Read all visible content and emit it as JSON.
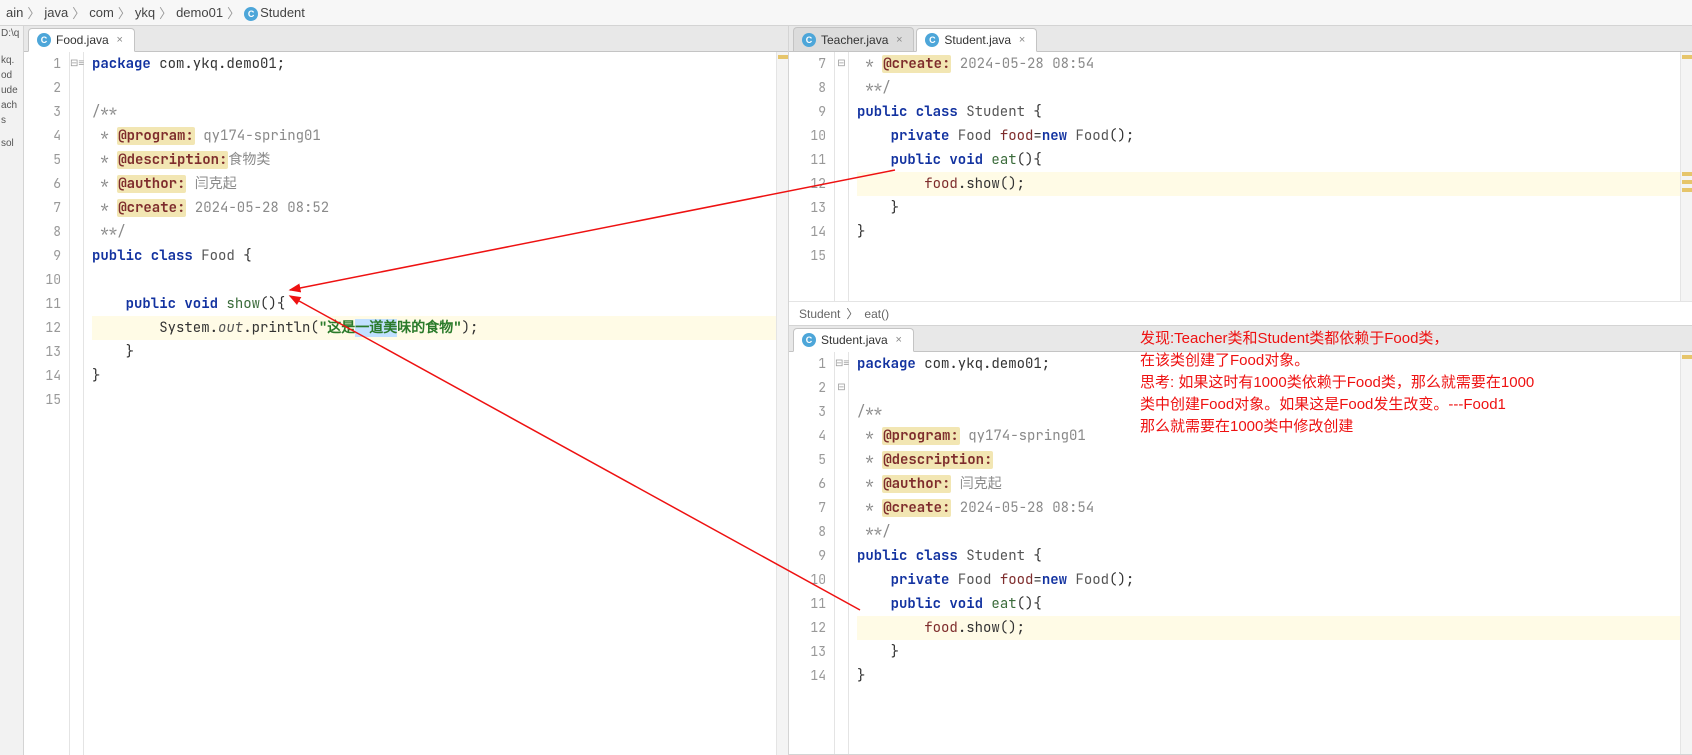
{
  "breadcrumb": [
    "ain",
    "java",
    "com",
    "ykq",
    "demo01",
    "Student"
  ],
  "left_strip": [
    "D:\\q",
    "",
    "",
    "",
    "kq.",
    "od",
    "ude",
    "ach",
    "s",
    "",
    "",
    "sol"
  ],
  "left_editor": {
    "tabs": [
      {
        "label": "Food.java",
        "active": true
      }
    ],
    "lines": [
      {
        "n": 1,
        "segs": [
          [
            "kw",
            "package "
          ],
          [
            "",
            "com.ykq.demo01;"
          ]
        ]
      },
      {
        "n": 2,
        "segs": []
      },
      {
        "n": 3,
        "fold": "⊟≡",
        "segs": [
          [
            "doc",
            "/**"
          ]
        ]
      },
      {
        "n": 4,
        "segs": [
          [
            "doc",
            " * "
          ],
          [
            "tag tag-hl",
            "@program:"
          ],
          [
            "doc",
            " qy174-spring01"
          ]
        ]
      },
      {
        "n": 5,
        "segs": [
          [
            "doc",
            " * "
          ],
          [
            "tag tag-hl",
            "@description:"
          ],
          [
            "doc",
            "食物类"
          ]
        ]
      },
      {
        "n": 6,
        "segs": [
          [
            "doc",
            " * "
          ],
          [
            "tag tag-hl",
            "@author:"
          ],
          [
            "doc",
            " 闫克起"
          ]
        ]
      },
      {
        "n": 7,
        "segs": [
          [
            "doc",
            " * "
          ],
          [
            "tag tag-hl",
            "@create:"
          ],
          [
            "doc",
            " 2024-05-28 08:52"
          ]
        ]
      },
      {
        "n": 8,
        "segs": [
          [
            "doc",
            " **/"
          ]
        ]
      },
      {
        "n": 9,
        "segs": [
          [
            "kw",
            "public class "
          ],
          [
            "cls",
            "Food "
          ],
          [
            "",
            "{"
          ]
        ]
      },
      {
        "n": 10,
        "segs": []
      },
      {
        "n": 11,
        "segs": [
          [
            "",
            "    "
          ],
          [
            "kw",
            "public void "
          ],
          [
            "fn",
            "show"
          ],
          [
            "",
            "(){"
          ]
        ]
      },
      {
        "n": 12,
        "hl": true,
        "segs": [
          [
            "",
            "        System."
          ],
          [
            "it",
            "out"
          ],
          [
            "",
            ".println("
          ],
          [
            "str",
            "\"这是"
          ],
          [
            "str sel",
            "一道美"
          ],
          [
            "str",
            "味的食物\""
          ],
          [
            "",
            ");"
          ]
        ]
      },
      {
        "n": 13,
        "segs": [
          [
            "",
            "    }"
          ]
        ]
      },
      {
        "n": 14,
        "segs": [
          [
            "",
            "}"
          ]
        ]
      },
      {
        "n": 15,
        "segs": []
      }
    ]
  },
  "right_top": {
    "tabs": [
      {
        "label": "Teacher.java",
        "active": false
      },
      {
        "label": "Student.java",
        "active": true
      }
    ],
    "lines": [
      {
        "n": 7,
        "segs": [
          [
            "doc",
            " * "
          ],
          [
            "tag tag-hl",
            "@create:"
          ],
          [
            "doc",
            " 2024-05-28 08:54"
          ]
        ]
      },
      {
        "n": 8,
        "fold": "⊟",
        "segs": [
          [
            "doc",
            " **/"
          ]
        ]
      },
      {
        "n": 9,
        "segs": [
          [
            "kw",
            "public class "
          ],
          [
            "cls",
            "Student "
          ],
          [
            "",
            "{"
          ]
        ]
      },
      {
        "n": 10,
        "segs": [
          [
            "",
            "    "
          ],
          [
            "kw",
            "private "
          ],
          [
            "cls",
            "Food "
          ],
          [
            "field",
            "food"
          ],
          [
            "",
            "="
          ],
          [
            "kw",
            "new "
          ],
          [
            "cls",
            "Food"
          ],
          [
            "",
            "();"
          ]
        ]
      },
      {
        "n": 11,
        "segs": [
          [
            "",
            "    "
          ],
          [
            "kw",
            "public void "
          ],
          [
            "fn",
            "eat"
          ],
          [
            "",
            "(){"
          ]
        ]
      },
      {
        "n": 12,
        "hl": true,
        "segs": [
          [
            "",
            "        "
          ],
          [
            "field",
            "food"
          ],
          [
            "",
            ".show();"
          ]
        ]
      },
      {
        "n": 13,
        "segs": [
          [
            "",
            "    }"
          ]
        ]
      },
      {
        "n": 14,
        "segs": [
          [
            "",
            "}"
          ]
        ]
      },
      {
        "n": 15,
        "segs": []
      }
    ],
    "sub_bc": [
      "Student",
      "eat()"
    ]
  },
  "right_bottom": {
    "tabs": [
      {
        "label": "Student.java",
        "active": true
      }
    ],
    "lines": [
      {
        "n": 1,
        "segs": [
          [
            "kw",
            "package "
          ],
          [
            "",
            "com.ykq.demo01;"
          ]
        ]
      },
      {
        "n": 2,
        "segs": []
      },
      {
        "n": 3,
        "fold": "⊟≡",
        "segs": [
          [
            "doc",
            "/**"
          ]
        ]
      },
      {
        "n": 4,
        "segs": [
          [
            "doc",
            " * "
          ],
          [
            "tag tag-hl",
            "@program:"
          ],
          [
            "doc",
            " qy174-spring01"
          ]
        ]
      },
      {
        "n": 5,
        "segs": [
          [
            "doc",
            " * "
          ],
          [
            "tag tag-hl",
            "@description:"
          ]
        ]
      },
      {
        "n": 6,
        "segs": [
          [
            "doc",
            " * "
          ],
          [
            "tag tag-hl",
            "@author:"
          ],
          [
            "doc",
            " 闫克起"
          ]
        ]
      },
      {
        "n": 7,
        "segs": [
          [
            "doc",
            " * "
          ],
          [
            "tag tag-hl",
            "@create:"
          ],
          [
            "doc",
            " 2024-05-28 08:54"
          ]
        ]
      },
      {
        "n": 8,
        "fold": "⊟",
        "segs": [
          [
            "doc",
            " **/"
          ]
        ]
      },
      {
        "n": 9,
        "segs": [
          [
            "kw",
            "public class "
          ],
          [
            "cls",
            "Student "
          ],
          [
            "",
            "{"
          ]
        ]
      },
      {
        "n": 10,
        "segs": [
          [
            "",
            "    "
          ],
          [
            "kw",
            "private "
          ],
          [
            "cls",
            "Food "
          ],
          [
            "field",
            "food"
          ],
          [
            "",
            "="
          ],
          [
            "kw",
            "new "
          ],
          [
            "cls",
            "Food"
          ],
          [
            "",
            "();"
          ]
        ]
      },
      {
        "n": 11,
        "segs": [
          [
            "",
            "    "
          ],
          [
            "kw",
            "public void "
          ],
          [
            "fn",
            "eat"
          ],
          [
            "",
            "(){"
          ]
        ]
      },
      {
        "n": 12,
        "hl": true,
        "segs": [
          [
            "",
            "        "
          ],
          [
            "field",
            "food"
          ],
          [
            "",
            ".show();"
          ]
        ]
      },
      {
        "n": 13,
        "segs": [
          [
            "",
            "    }"
          ]
        ]
      },
      {
        "n": 14,
        "segs": [
          [
            "",
            "}"
          ]
        ]
      }
    ]
  },
  "annotation": {
    "text": "发现:Teacher类和Student类都依赖于Food类，\n在该类创建了Food对象。\n思考: 如果这时有1000类依赖于Food类，那么就需要在1000\n类中创建Food对象。如果这是Food发生改变。---Food1\n那么就需要在1000类中修改创建"
  }
}
